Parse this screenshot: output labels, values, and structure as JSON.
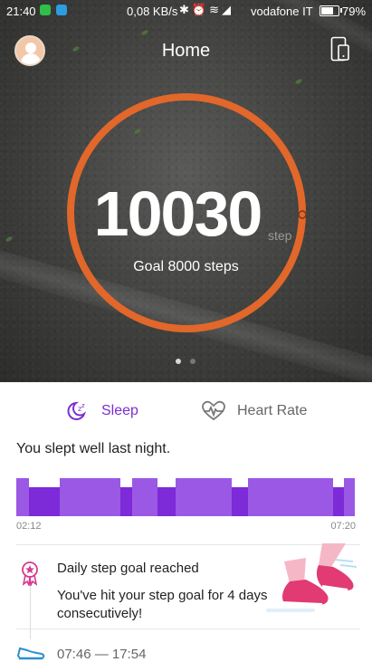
{
  "status_bar": {
    "time": "21:40",
    "network_speed": "0,08 KB/s",
    "carrier": "vodafone IT",
    "battery": "79%"
  },
  "header": {
    "title": "Home"
  },
  "steps": {
    "count": "10030",
    "unit": "step",
    "goal": "Goal 8000 steps",
    "progress_fraction": 1.0
  },
  "tabs": {
    "sleep": "Sleep",
    "heart_rate": "Heart Rate"
  },
  "sleep": {
    "message": "You slept well last night.",
    "start_time": "02:12",
    "end_time": "07:20"
  },
  "activity": {
    "title": "Daily step goal reached",
    "body": "You've hit your step goal for 4 days consecutively!",
    "time_range": "07:46 — 17:54"
  },
  "colors": {
    "accent": "#7b2fd0",
    "ring": "#e2672a",
    "sleep_deep": "#7d2ad8",
    "sleep_light": "#9b58e4",
    "medal": "#d63a8f",
    "shoe": "#2a8fd0"
  }
}
